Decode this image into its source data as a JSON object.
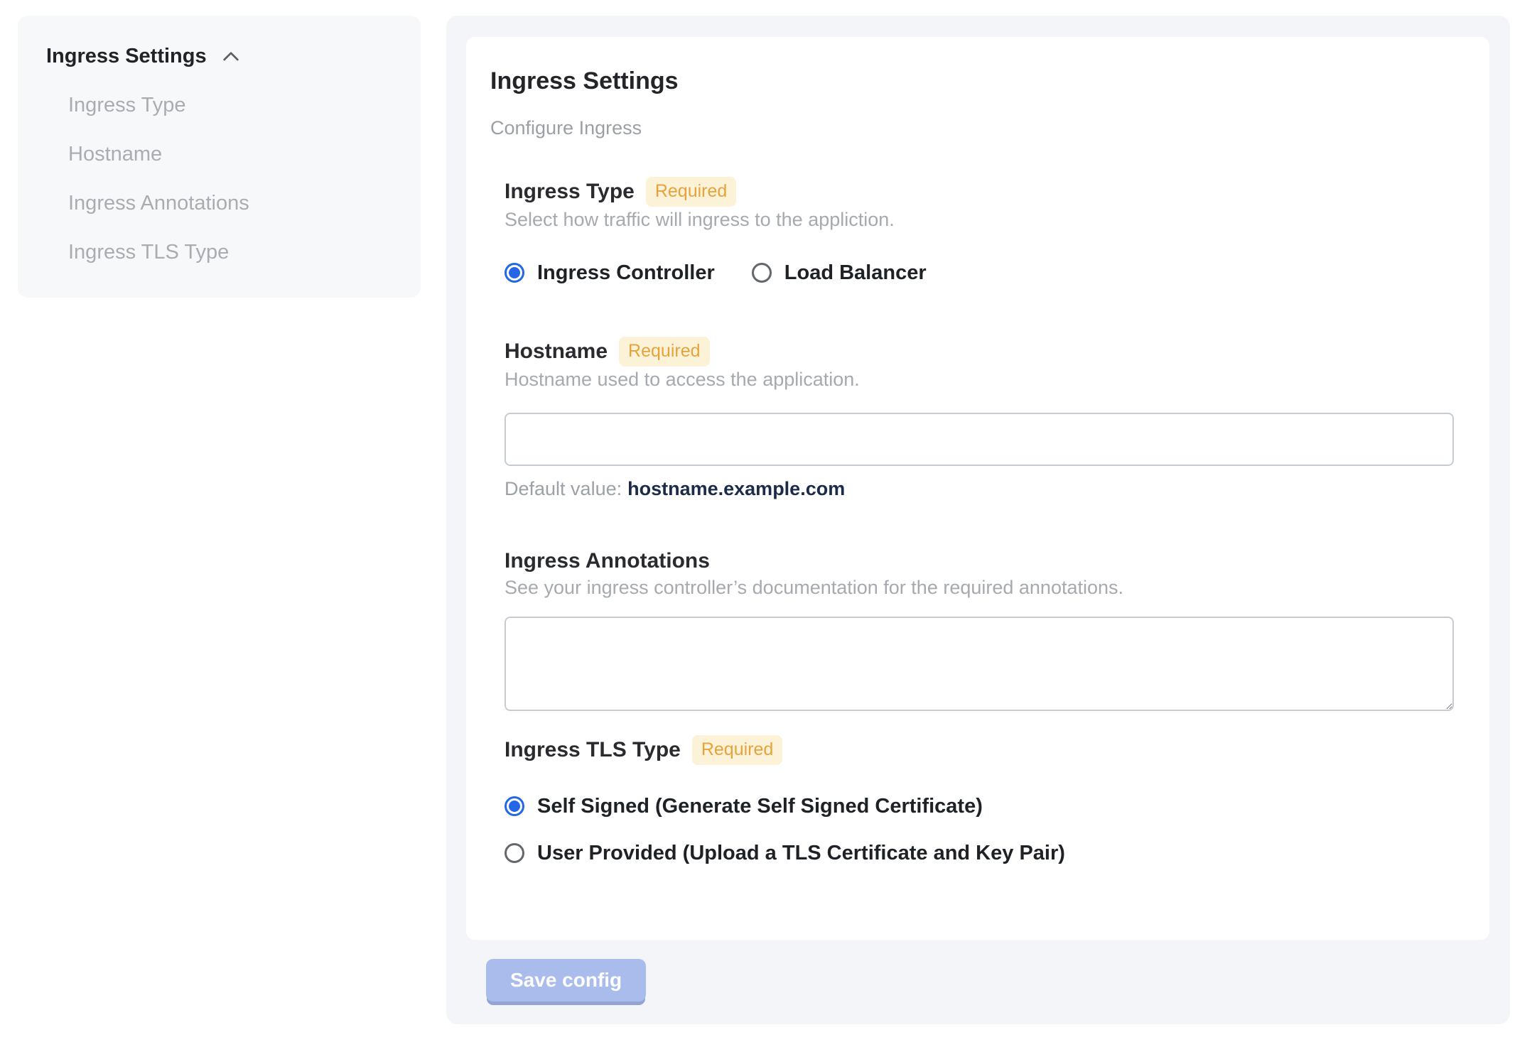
{
  "sidebar": {
    "title": "Ingress Settings",
    "collapse_icon": "chevron-up-icon",
    "items": [
      {
        "label": "Ingress Type"
      },
      {
        "label": "Hostname"
      },
      {
        "label": "Ingress Annotations"
      },
      {
        "label": "Ingress TLS Type"
      }
    ]
  },
  "main": {
    "title": "Ingress Settings",
    "subtitle": "Configure Ingress",
    "required_label": "Required",
    "sections": {
      "ingress_type": {
        "label": "Ingress Type",
        "required": true,
        "description": "Select how traffic will ingress to the appliction.",
        "options": [
          {
            "label": "Ingress Controller",
            "selected": true
          },
          {
            "label": "Load Balancer",
            "selected": false
          }
        ]
      },
      "hostname": {
        "label": "Hostname",
        "required": true,
        "description": "Hostname used to access the application.",
        "input_value": "",
        "default_value_label": "Default value:",
        "default_value": "hostname.example.com"
      },
      "annotations": {
        "label": "Ingress Annotations",
        "required": false,
        "description": "See your ingress controller’s documentation for the required annotations.",
        "textarea_value": ""
      },
      "tls_type": {
        "label": "Ingress TLS Type",
        "required": true,
        "options": [
          {
            "label": "Self Signed (Generate Self Signed Certificate)",
            "selected": true
          },
          {
            "label": "User Provided (Upload a TLS Certificate and Key Pair)",
            "selected": false
          }
        ]
      }
    },
    "save_button": "Save config"
  },
  "colors": {
    "accent_blue": "#2367e7",
    "badge_bg": "#fcf2d8",
    "badge_text": "#e6a33c",
    "save_button_bg": "#a9bcec",
    "save_button_edge": "#93a4d4",
    "default_value_text": "#1c2b4a",
    "sidebar_bg": "#f7f8f9",
    "panel_bg": "#f3f5f8",
    "card_bg": "#ffffff",
    "muted_text": "#a6aaaf"
  }
}
